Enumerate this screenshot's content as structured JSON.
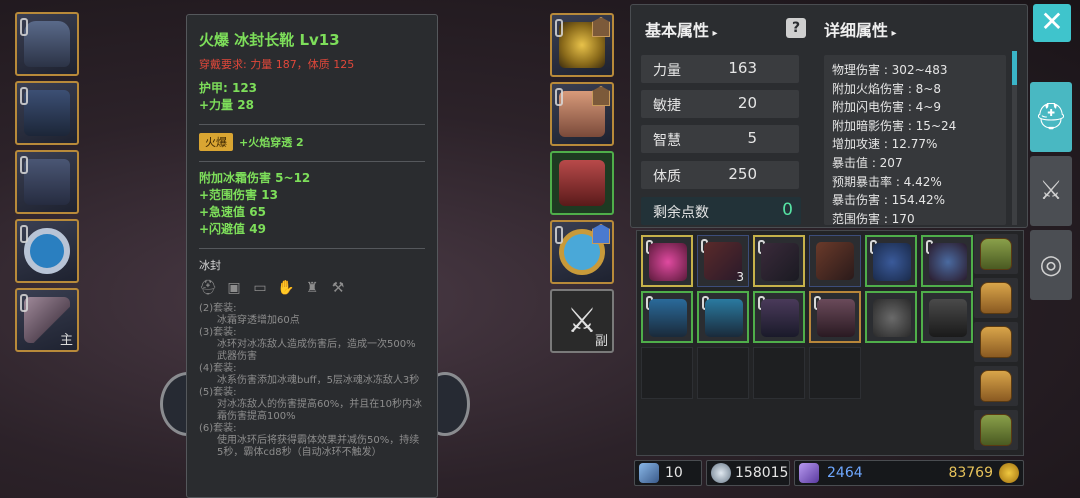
{
  "tooltip": {
    "title": "火爆  冰封长靴  Lv13",
    "requirement": "穿戴要求:    力量 187，体质 125",
    "base_stats": [
      "护甲:  123",
      "+力量 28"
    ],
    "tag": "火爆",
    "tag_stat": "+火焰穿透 2",
    "extra_stats": [
      "附加冰霜伤害 5~12",
      "+范围伤害 13",
      "+急速值 65",
      "+闪避值 49"
    ],
    "set_name": "冰封",
    "set_bonuses": [
      {
        "label": "(2)套装:",
        "desc": "冰霜穿透增加60点"
      },
      {
        "label": "(3)套装:",
        "desc": "冰环对冰冻敌人造成伤害后，造成一次500%武器伤害"
      },
      {
        "label": "(4)套装:",
        "desc": "冰系伤害添加冰魂buff，5层冰魂冰冻敌人3秒"
      },
      {
        "label": "(5)套装:",
        "desc": "对冰冻敌人的伤害提高60%，并且在10秒内冰霜伤害提高100%"
      },
      {
        "label": "(6)套装:",
        "desc": "使用冰环后将获得霸体效果并减伤50%，持续5秒，霸体cd8秒（自动冰环不触发）"
      }
    ]
  },
  "left_slots": [
    {
      "icon": "chest-armor-icon",
      "label": ""
    },
    {
      "icon": "cloak-icon",
      "label": ""
    },
    {
      "icon": "leg-armor-icon",
      "label": ""
    },
    {
      "icon": "ring-icon",
      "label": ""
    },
    {
      "icon": "axe-icon",
      "label": "主"
    }
  ],
  "mid_slots": [
    {
      "icon": "helmet-icon",
      "label": ""
    },
    {
      "icon": "glove-icon",
      "label": ""
    },
    {
      "icon": "boots-icon",
      "label": ""
    },
    {
      "icon": "amulet-icon",
      "label": ""
    },
    {
      "icon": "sword-icon",
      "label": "副"
    }
  ],
  "stats": {
    "basic_header": "基本属性",
    "detail_header": "详细属性",
    "rows": [
      {
        "key": "力量",
        "value": "163"
      },
      {
        "key": "敏捷",
        "value": "20"
      },
      {
        "key": "智慧",
        "value": "5"
      },
      {
        "key": "体质",
        "value": "250"
      }
    ],
    "points_label": "剩余点数",
    "points_value": "0",
    "details": [
      "物理伤害 : 302~483",
      "附加火焰伤害 : 8~8",
      "附加闪电伤害 : 4~9",
      "附加暗影伤害 : 15~24",
      "增加攻速 : 12.77%",
      "暴击值 : 207",
      "预期暴击率 : 4.42%",
      "暴击伤害 : 154.42%",
      "范围伤害 : 170"
    ]
  },
  "inventory": {
    "count_label": "3"
  },
  "currency": {
    "scrolls": "10",
    "silver": "158015",
    "gems": "2464",
    "gold": "83769"
  },
  "colors": {
    "accent": "#3fc4cc",
    "green_text": "#7dde5a",
    "red_text": "#e0473a",
    "gem_text": "#6fa8ff"
  }
}
